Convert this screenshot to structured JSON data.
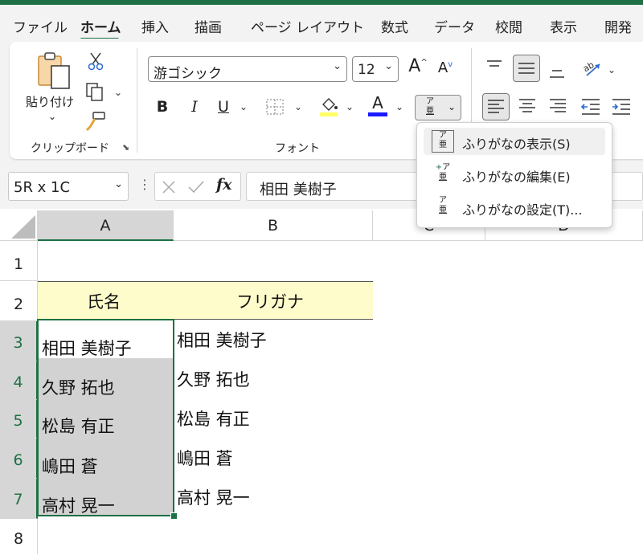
{
  "ribbon_tabs": [
    "ファイル",
    "ホーム",
    "挿入",
    "描画",
    "ページ レイアウト",
    "数式",
    "データ",
    "校閲",
    "表示",
    "開発"
  ],
  "active_tab": "ホーム",
  "clipboard": {
    "paste_label": "貼り付け",
    "group_label": "クリップボード"
  },
  "font": {
    "name": "游ゴシック",
    "size": "12",
    "group_label": "フォント",
    "bold": "B",
    "italic": "I",
    "underline": "U",
    "font_color_glyph": "A",
    "phonetic_glyph_top": "ア",
    "phonetic_glyph_bottom": "亜",
    "grow_glyph": "A",
    "shrink_glyph": "A"
  },
  "phonetic_menu": {
    "items": [
      {
        "label": "ふりがなの表示(S)",
        "icon": "phonetic-show-icon"
      },
      {
        "label": "ふりがなの編集(E)",
        "icon": "phonetic-edit-icon"
      },
      {
        "label": "ふりがなの設定(T)...",
        "icon": "phonetic-settings-icon"
      }
    ]
  },
  "formula_bar": {
    "name_box": "5R x 1C",
    "fx": "fx",
    "content": "相田 美樹子"
  },
  "columns": [
    "A",
    "B",
    "C",
    "D"
  ],
  "rows": [
    "1",
    "2",
    "3",
    "4",
    "5",
    "6",
    "7",
    "8"
  ],
  "table": {
    "headers": [
      "氏名",
      "フリガナ"
    ],
    "names": [
      "相田 美樹子",
      "久野 拓也",
      "松島 有正",
      "嶋田 蒼",
      "高村 晃一"
    ],
    "furigana": [
      "相田 美樹子",
      "久野 拓也",
      "松島 有正",
      "嶋田 蒼",
      "高村 晃一"
    ]
  },
  "colors": {
    "accent": "#1e7145",
    "header_fill": "#fffccc",
    "selection_fill": "#d2d2d2",
    "font_color_bar": "#1a1aff",
    "fill_color_bar": "#ffff66"
  }
}
